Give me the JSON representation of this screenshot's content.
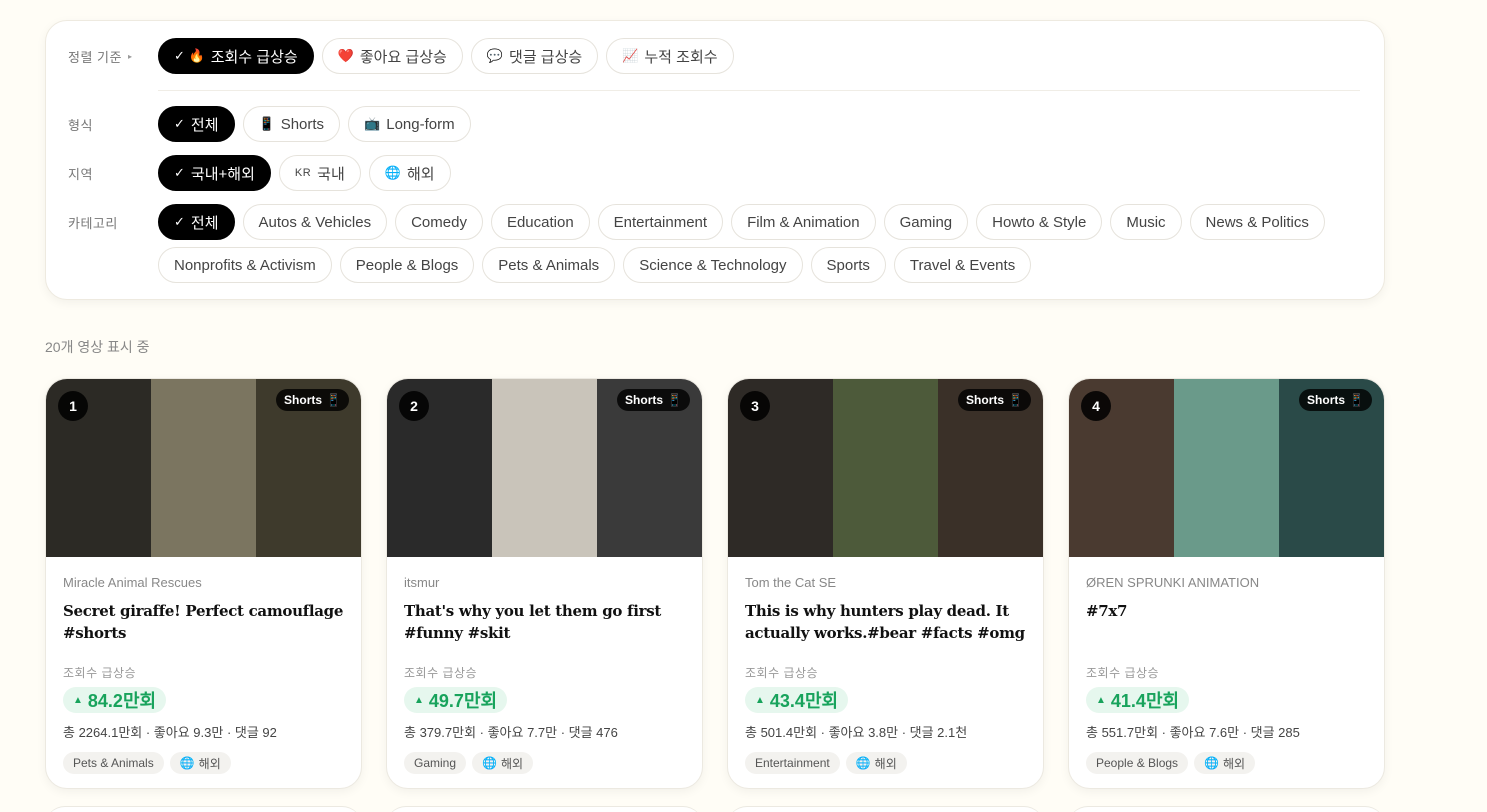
{
  "sort": {
    "label": "정렬 기준",
    "options": [
      {
        "icon": "✓ 🔥",
        "label": "조회수 급상승",
        "active": true
      },
      {
        "icon": "❤️",
        "label": "좋아요 급상승",
        "active": false
      },
      {
        "icon": "💬",
        "label": "댓글 급상승",
        "active": false
      },
      {
        "icon": "📈",
        "label": "누적 조회수",
        "active": false
      }
    ]
  },
  "format": {
    "label": "형식",
    "options": [
      {
        "icon": "✓",
        "label": "전체",
        "active": true
      },
      {
        "icon": "📱",
        "label": "Shorts",
        "active": false
      },
      {
        "icon": "📺",
        "label": "Long-form",
        "active": false
      }
    ]
  },
  "region": {
    "label": "지역",
    "options": [
      {
        "icon": "✓",
        "label": "국내+해외",
        "active": true
      },
      {
        "icon": "KR",
        "label": "국내",
        "active": false
      },
      {
        "icon": "🌐",
        "label": "해외",
        "active": false
      }
    ]
  },
  "category": {
    "label": "카테고리",
    "row1": [
      {
        "icon": "✓",
        "label": "전체",
        "active": true
      },
      {
        "label": "Autos & Vehicles"
      },
      {
        "label": "Comedy"
      },
      {
        "label": "Education"
      },
      {
        "label": "Entertainment"
      },
      {
        "label": "Film & Animation"
      },
      {
        "label": "Gaming"
      },
      {
        "label": "Howto & Style"
      },
      {
        "label": "Music"
      },
      {
        "label": "News & Politics"
      }
    ],
    "row2": [
      {
        "label": "Nonprofits & Activism"
      },
      {
        "label": "People & Blogs"
      },
      {
        "label": "Pets & Animals"
      },
      {
        "label": "Science & Technology"
      },
      {
        "label": "Sports"
      },
      {
        "label": "Travel & Events"
      }
    ]
  },
  "result_count": "20개 영상 표시 중",
  "cards": [
    {
      "rank": "1",
      "badge": "Shorts",
      "badge_icon": "📱",
      "thumb_colors": [
        "#2c2a25",
        "#7b7560",
        "#3e3a2c"
      ],
      "channel": "Miracle Animal Rescues",
      "title": "Secret giraffe! Perfect camouflage #shorts",
      "metric_label": "조회수 급상승",
      "growth": "84.2만회",
      "stats": "총 2264.1만회 · 좋아요 9.3만 · 댓글 92",
      "category": "Pets & Animals",
      "region_icon": "🌐",
      "region": "해외"
    },
    {
      "rank": "2",
      "badge": "Shorts",
      "badge_icon": "📱",
      "thumb_colors": [
        "#2a2a2a",
        "#c9c4ba",
        "#3a3a3a"
      ],
      "channel": "itsmur",
      "title": "That's why you let them go first #funny #skit",
      "metric_label": "조회수 급상승",
      "growth": "49.7만회",
      "stats": "총 379.7만회 · 좋아요 7.7만 · 댓글 476",
      "category": "Gaming",
      "region_icon": "🌐",
      "region": "해외"
    },
    {
      "rank": "3",
      "badge": "Shorts",
      "badge_icon": "📱",
      "thumb_colors": [
        "#2e2a26",
        "#4d5a3a",
        "#3a3028"
      ],
      "channel": "Tom the Cat SE",
      "title": "This is why hunters play dead. It actually works.#bear #facts #omg #animal",
      "metric_label": "조회수 급상승",
      "growth": "43.4만회",
      "stats": "총 501.4만회 · 좋아요 3.8만 · 댓글 2.1천",
      "category": "Entertainment",
      "region_icon": "🌐",
      "region": "해외"
    },
    {
      "rank": "4",
      "badge": "Shorts",
      "badge_icon": "📱",
      "thumb_colors": [
        "#4a3a30",
        "#6a9a8a",
        "#2a4a48"
      ],
      "channel": "ØREN SPRUNKI ANIMATION",
      "title": "#7x7",
      "metric_label": "조회수 급상승",
      "growth": "41.4만회",
      "stats": "총 551.7만회 · 좋아요 7.6만 · 댓글 285",
      "category": "People & Blogs",
      "region_icon": "🌐",
      "region": "해외"
    }
  ]
}
